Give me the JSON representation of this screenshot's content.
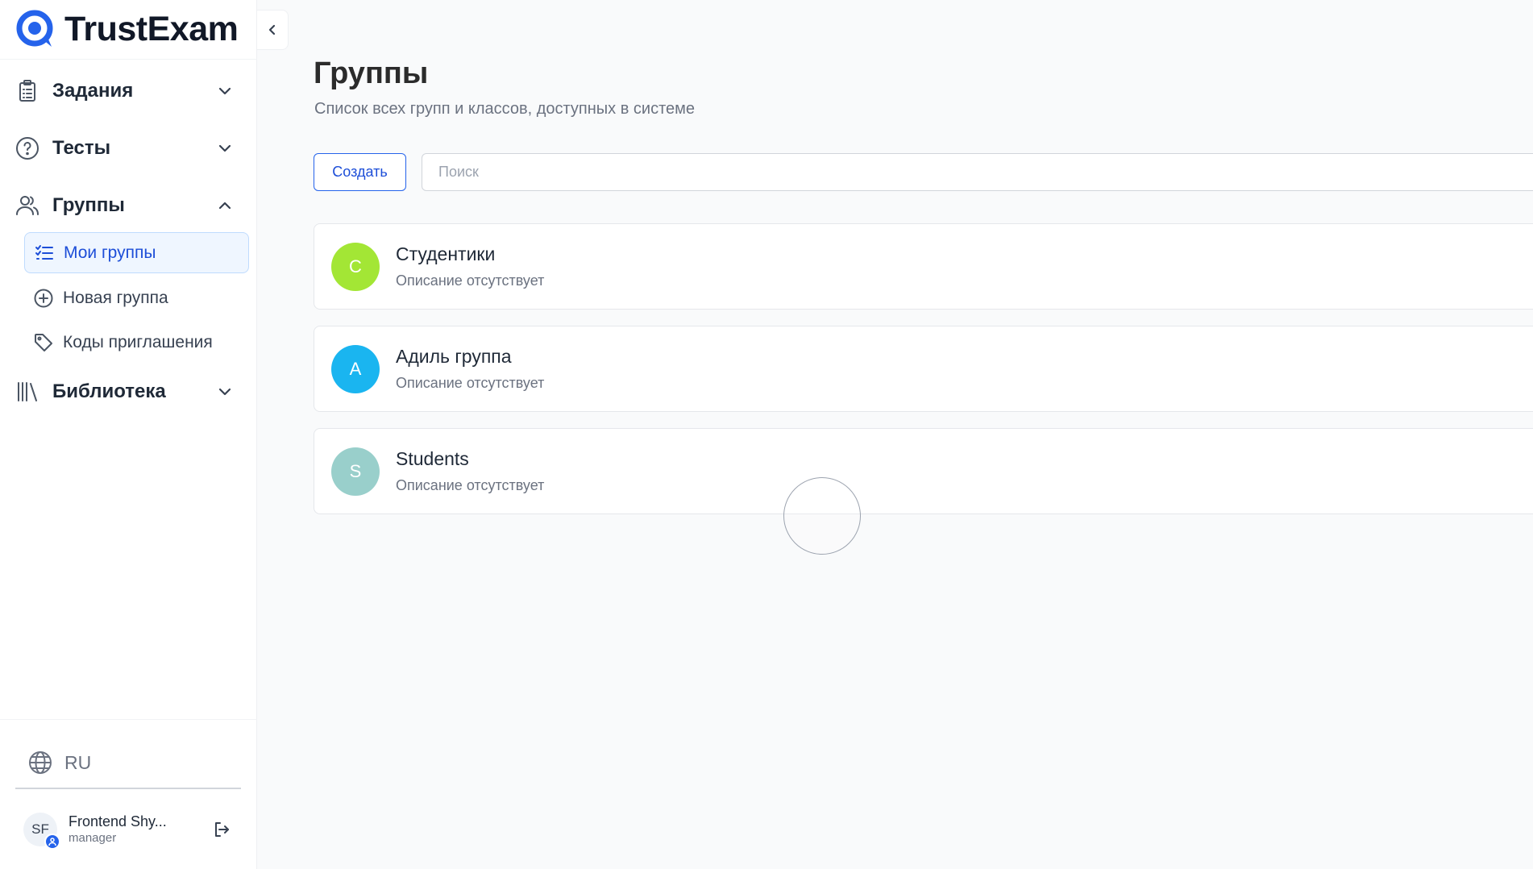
{
  "app": {
    "name": "TrustExam",
    "brand_color": "#2563eb"
  },
  "sidebar": {
    "nav": [
      {
        "label": "Задания",
        "icon": "clipboard-icon",
        "expanded": false
      },
      {
        "label": "Тесты",
        "icon": "question-circle-icon",
        "expanded": false
      },
      {
        "label": "Группы",
        "icon": "users-icon",
        "expanded": true
      },
      {
        "label": "Библиотека",
        "icon": "library-icon",
        "expanded": false
      }
    ],
    "groups_sub": [
      {
        "label": "Мои группы",
        "icon": "checklist-icon",
        "active": true
      },
      {
        "label": "Новая группа",
        "icon": "plus-circle-icon",
        "active": false
      },
      {
        "label": "Коды приглашения",
        "icon": "tag-icon",
        "active": false
      }
    ],
    "language": "RU",
    "user": {
      "initials": "SF",
      "name": "Frontend Shy...",
      "role": "manager"
    }
  },
  "main": {
    "title": "Группы",
    "subtitle": "Список всех групп и классов, доступных в системе",
    "create_label": "Создать",
    "search_placeholder": "Поиск",
    "groups": [
      {
        "initial": "С",
        "name": "Студентики",
        "description": "Описание отсутствует",
        "color": "#a3e635"
      },
      {
        "initial": "А",
        "name": "Адиль группа",
        "description": "Описание отсутствует",
        "color": "#1ab5f0"
      },
      {
        "initial": "S",
        "name": "Students",
        "description": "Описание отсутствует",
        "color": "#99cfcb"
      }
    ]
  }
}
